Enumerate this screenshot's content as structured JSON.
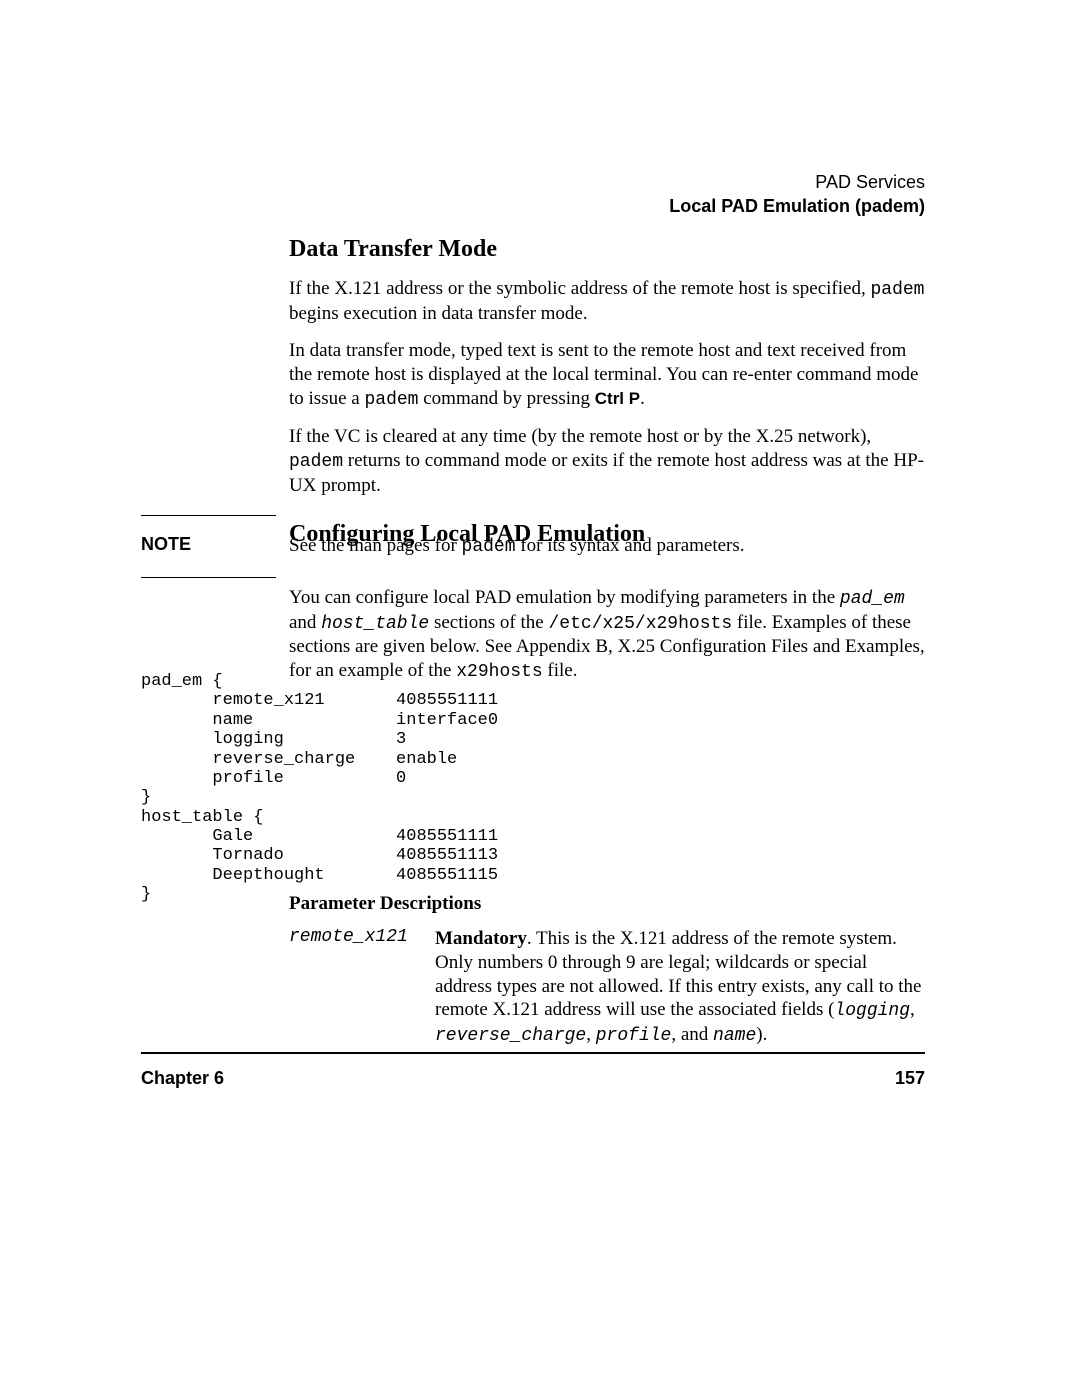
{
  "header": {
    "section": "PAD Services",
    "subsection": "Local PAD Emulation (padem)"
  },
  "h_data_transfer": "Data Transfer Mode",
  "p1_a": "If the X.121 address or the symbolic address of the remote host is specified, ",
  "p1_mono": "padem",
  "p1_b": " begins execution in data transfer mode.",
  "p2_a": "In data transfer mode, typed text is sent to the remote host and text received from the remote host is displayed at the local terminal. You can re-enter command mode to issue a ",
  "p2_mono": "padem",
  "p2_b": " command by pressing ",
  "p2_key": "Ctrl P",
  "p2_c": ".",
  "p3_a": "If the VC is cleared at any time (by the remote host or by the X.25 network), ",
  "p3_mono": "padem",
  "p3_b": " returns to command mode or exits if the remote host address was at the HP-UX prompt.",
  "h_config": "Configuring Local PAD Emulation",
  "note_label": "NOTE",
  "note_a": "See the man pages for ",
  "note_mono": "padem",
  "note_b": " for its syntax and parameters.",
  "p4_a": "You can configure local PAD emulation by modifying parameters in the ",
  "p4_m1": "pad_em",
  "p4_b": " and ",
  "p4_m2": "host_table",
  "p4_c": " sections of the ",
  "p4_m3": "/etc/x25/x29hosts",
  "p4_d": " file. Examples of these sections are given below. See Appendix B, X.25 Configuration Files and Examples, for an example of the ",
  "p4_m4": "x29hosts",
  "p4_e": " file.",
  "code": "pad_em {\n       remote_x121       4085551111\n       name              interface0\n       logging           3\n       reverse_charge    enable\n       profile           0\n}\nhost_table {\n       Gale              4085551111\n       Tornado           4085551113\n       Deepthought       4085551115\n}",
  "h_param": "Parameter Descriptions",
  "param_name": "remote_x121",
  "param_bold": "Mandatory",
  "param_a": ". This is the X.121 address of the remote system. Only numbers 0 through 9 are legal; wildcards or special address types are not allowed. If this entry exists, any call to the remote X.121 address will use the associated fields (",
  "param_f1": "logging",
  "param_s1": ", ",
  "param_f2": "reverse_charge",
  "param_s2": ", ",
  "param_f3": "profile",
  "param_s3": ", and ",
  "param_f4": "name",
  "param_b": ").",
  "footer": {
    "chapter": "Chapter 6",
    "page": "157"
  }
}
